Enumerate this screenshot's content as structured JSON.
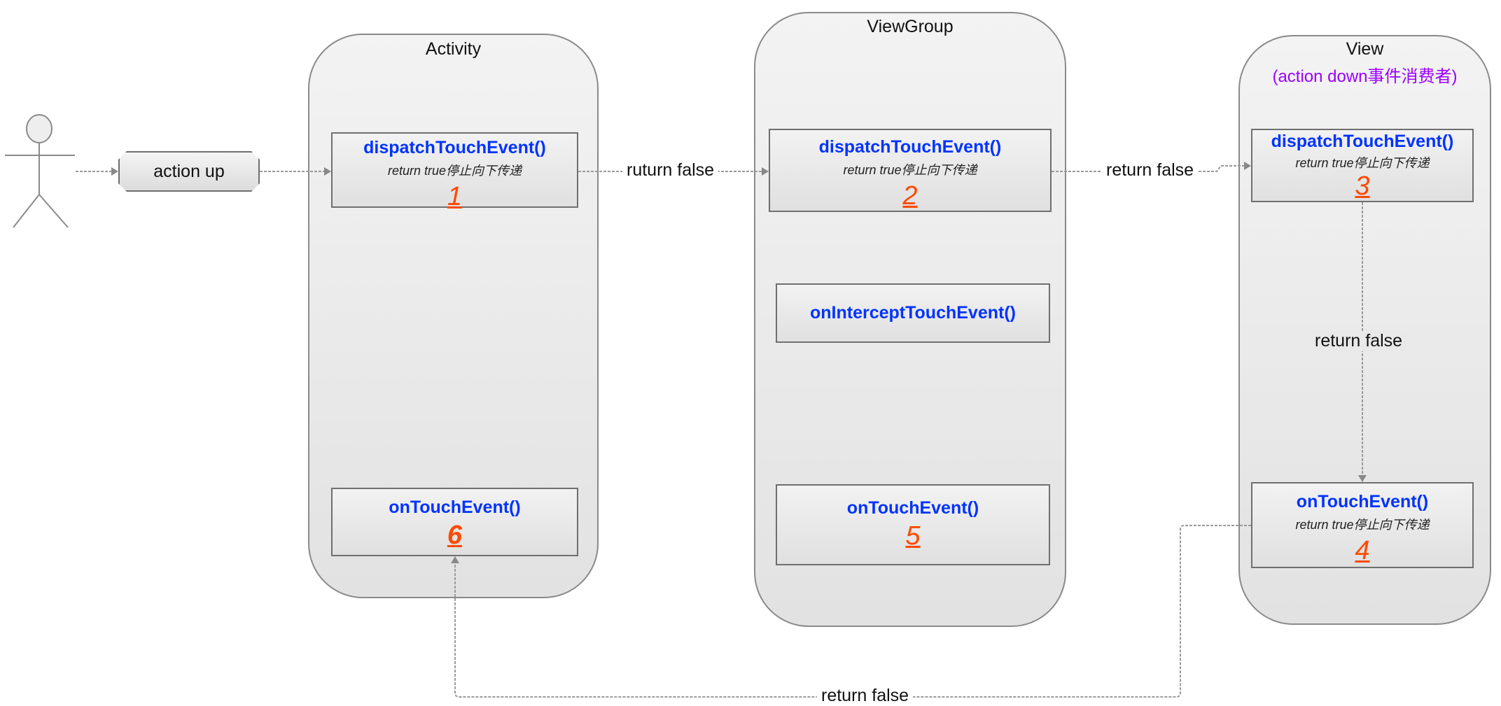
{
  "actor": {
    "icon": "stick-figure-icon"
  },
  "trigger": {
    "label": "action up"
  },
  "lanes": {
    "activity": {
      "title": "Activity"
    },
    "viewgroup": {
      "title": "ViewGroup"
    },
    "view": {
      "title": "View",
      "subtitle": "(action down事件消费者)",
      "subtitle_color": "#9b00ff"
    }
  },
  "boxes": {
    "activity_dispatch": {
      "method": "dispatchTouchEvent()",
      "note": "return true停止向下传递",
      "step": "1"
    },
    "activity_touch": {
      "method": "onTouchEvent()",
      "step": "6"
    },
    "vg_dispatch": {
      "method": "dispatchTouchEvent()",
      "note": "return true停止向下传递",
      "step": "2"
    },
    "vg_intercept": {
      "method": "onInterceptTouchEvent()"
    },
    "vg_touch": {
      "method": "onTouchEvent()",
      "step": "5"
    },
    "view_dispatch": {
      "method": "dispatchTouchEvent()",
      "note": "return true停止向下传递",
      "step": "3"
    },
    "view_touch": {
      "method": "onTouchEvent()",
      "note": "return true停止向下传递",
      "step": "4"
    }
  },
  "edges": {
    "activity_to_vg": "ruturn false",
    "vg_to_view": "return false",
    "view_dispatch_to_touch": "return false",
    "view_to_activity": "return false"
  },
  "colors": {
    "method": "#0033ff",
    "step": "#ff4a00",
    "lane_border": "#8a8a8a"
  }
}
